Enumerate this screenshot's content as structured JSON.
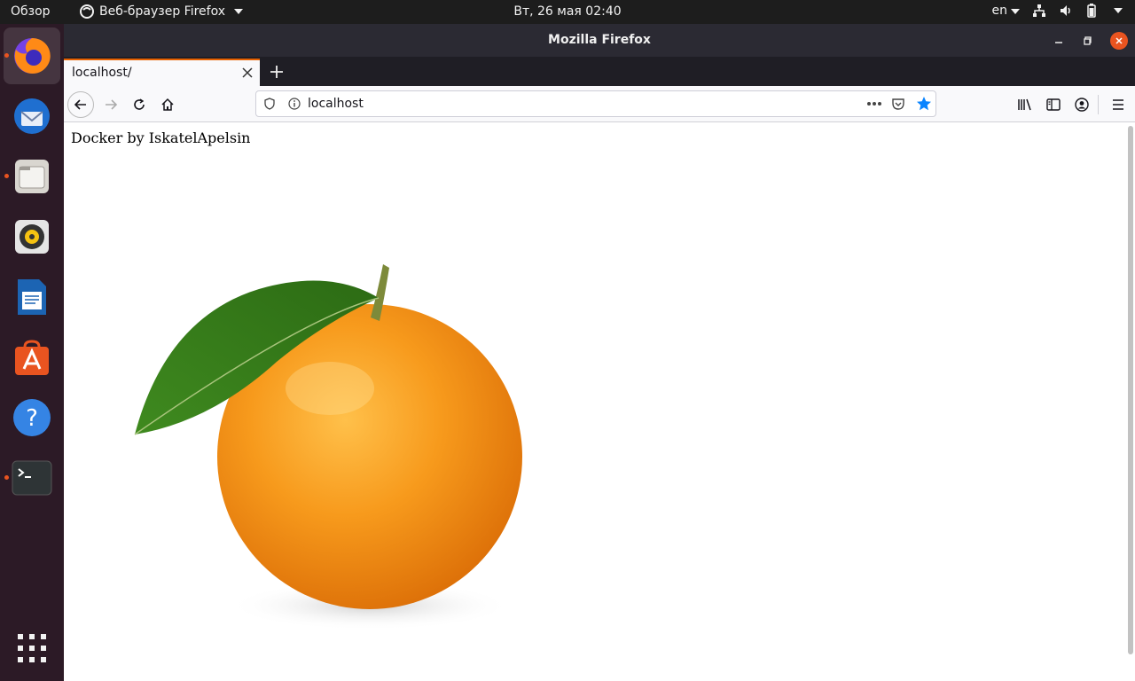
{
  "topbar": {
    "activities": "Обзор",
    "app_menu": "Веб-браузер Firefox",
    "clock": "Вт, 26 мая  02:40",
    "lang": "en"
  },
  "dock": {
    "items": [
      "firefox-icon",
      "thunderbird-icon",
      "files-icon",
      "rhythmbox-icon",
      "writer-icon",
      "software-icon",
      "help-icon",
      "terminal-icon",
      "app-grid-icon"
    ]
  },
  "window": {
    "title": "Mozilla Firefox",
    "tab_title": "localhost/",
    "url": "localhost"
  },
  "page": {
    "heading": "Docker by IskatelApelsin"
  },
  "colors": {
    "accent": "#e95420",
    "tab_highlight": "#e66000",
    "bookmark_star": "#0a84ff"
  }
}
